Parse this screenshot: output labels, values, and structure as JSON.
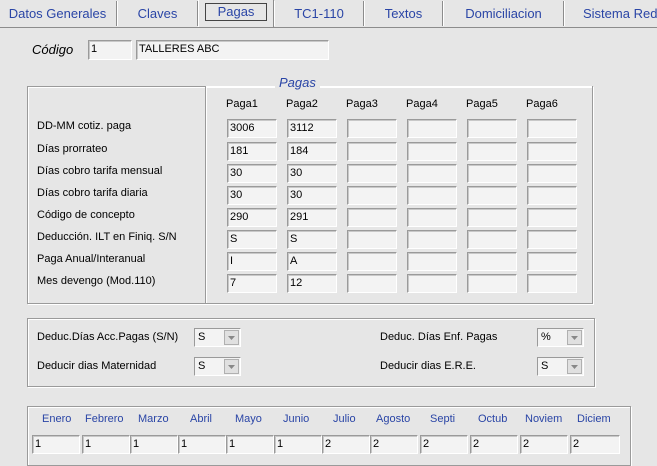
{
  "tabs": [
    "Datos Generales",
    "Claves",
    "Pagas",
    "TC1-110",
    "Textos",
    "Domiciliacion",
    "Sistema Red"
  ],
  "active_tab": "Pagas",
  "codigo": {
    "label": "Código",
    "value": "1",
    "name": "TALLERES ABC"
  },
  "pagas": {
    "legend": "Pagas",
    "columns": [
      "Paga1",
      "Paga2",
      "Paga3",
      "Paga4",
      "Paga5",
      "Paga6"
    ],
    "rows": [
      {
        "label": "DD-MM cotiz. paga",
        "values": [
          "3006",
          "3112",
          "",
          "",
          "",
          ""
        ]
      },
      {
        "label": "Días prorrateo",
        "values": [
          "181",
          "184",
          "",
          "",
          "",
          ""
        ]
      },
      {
        "label": "Días cobro tarifa mensual",
        "values": [
          "30",
          "30",
          "",
          "",
          "",
          ""
        ]
      },
      {
        "label": "Días cobro tarifa diaria",
        "values": [
          "30",
          "30",
          "",
          "",
          "",
          ""
        ]
      },
      {
        "label": "Código de concepto",
        "values": [
          "290",
          "291",
          "",
          "",
          "",
          ""
        ]
      },
      {
        "label": "Deducción. ILT en Finiq. S/N",
        "values": [
          "S",
          "S",
          "",
          "",
          "",
          ""
        ]
      },
      {
        "label": "Paga Anual/Interanual",
        "values": [
          "I",
          "A",
          "",
          "",
          "",
          ""
        ]
      },
      {
        "label": "Mes devengo (Mod.110)",
        "values": [
          "7",
          "12",
          "",
          "",
          "",
          ""
        ]
      }
    ]
  },
  "deduc": {
    "acc_label": "Deduc.Días Acc.Pagas (S/N)",
    "acc_value": "S",
    "mat_label": "Deducir dias Maternidad",
    "mat_value": "S",
    "enf_label": "Deduc. Días Enf. Pagas",
    "enf_value": "%",
    "ere_label": "Deducir dias E.R.E.",
    "ere_value": "S"
  },
  "months": {
    "labels": [
      "Enero",
      "Febrero",
      "Marzo",
      "Abril",
      "Mayo",
      "Junio",
      "Julio",
      "Agosto",
      "Septi",
      "Octub",
      "Noviem",
      "Diciem"
    ],
    "values": [
      "1",
      "1",
      "1",
      "1",
      "1",
      "1",
      "2",
      "2",
      "2",
      "2",
      "2",
      "2"
    ]
  },
  "colors": {
    "accent": "#2a45a6",
    "background": "#e6e6e6"
  }
}
